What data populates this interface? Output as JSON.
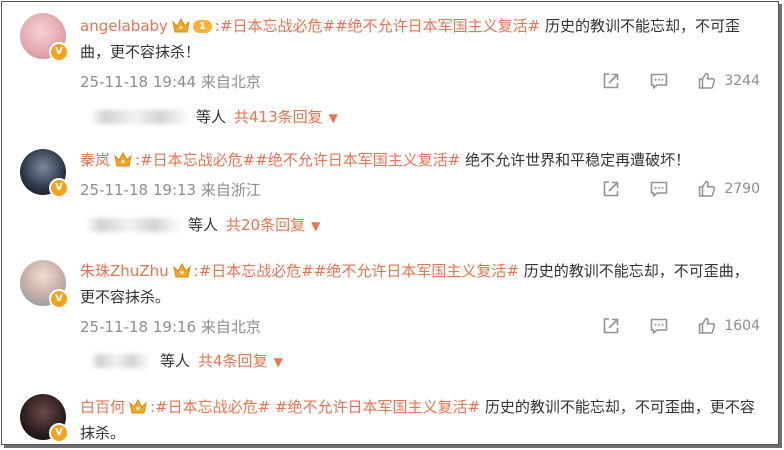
{
  "comments": [
    {
      "user": "angelababy",
      "level_badge": "1",
      "hashtag1": ":#日本忘战必危#",
      "hashtag2": "#绝不允许日本军国主义复活#",
      "text": " 历史的教训不能忘却，不可歪曲，更不容抹杀！",
      "time": "25-11-18 19:44 来自北京",
      "likes": "3244",
      "replies_prefix": "等人",
      "replies_link": "共413条回复"
    },
    {
      "user": "秦岚",
      "hashtag1": ":#日本忘战必危#",
      "hashtag2": "#绝不允许日本军国主义复活#",
      "text": " 绝不允许世界和平稳定再遭破坏！",
      "time": "25-11-18 19:13 来自浙江",
      "likes": "2790",
      "replies_prefix": "等人",
      "replies_link": "共20条回复"
    },
    {
      "user": "朱珠ZhuZhu",
      "hashtag1": ":#日本忘战必危#",
      "hashtag2": "#绝不允许日本军国主义复活#",
      "text": " 历史的教训不能忘却，不可歪曲，更不容抹杀。",
      "time": "25-11-18 19:16 来自北京",
      "likes": "1604",
      "replies_prefix": "等人",
      "replies_link": "共4条回复"
    },
    {
      "user": "白百何",
      "hashtag1": ":#日本忘战必危#",
      "hashtag2": " #绝不允许日本军国主义复活#",
      "text": " 历史的教训不能忘却，不可歪曲，更不容抹杀。"
    }
  ],
  "icons": {
    "share": "share-icon",
    "comment": "comment-icon",
    "like": "thumbs-up-icon",
    "verified": "verified-v-icon",
    "crown": "crown-icon"
  },
  "colors": {
    "accent": "#eb7350",
    "meta": "#8e8e8e",
    "verified": "#f7a21b"
  }
}
